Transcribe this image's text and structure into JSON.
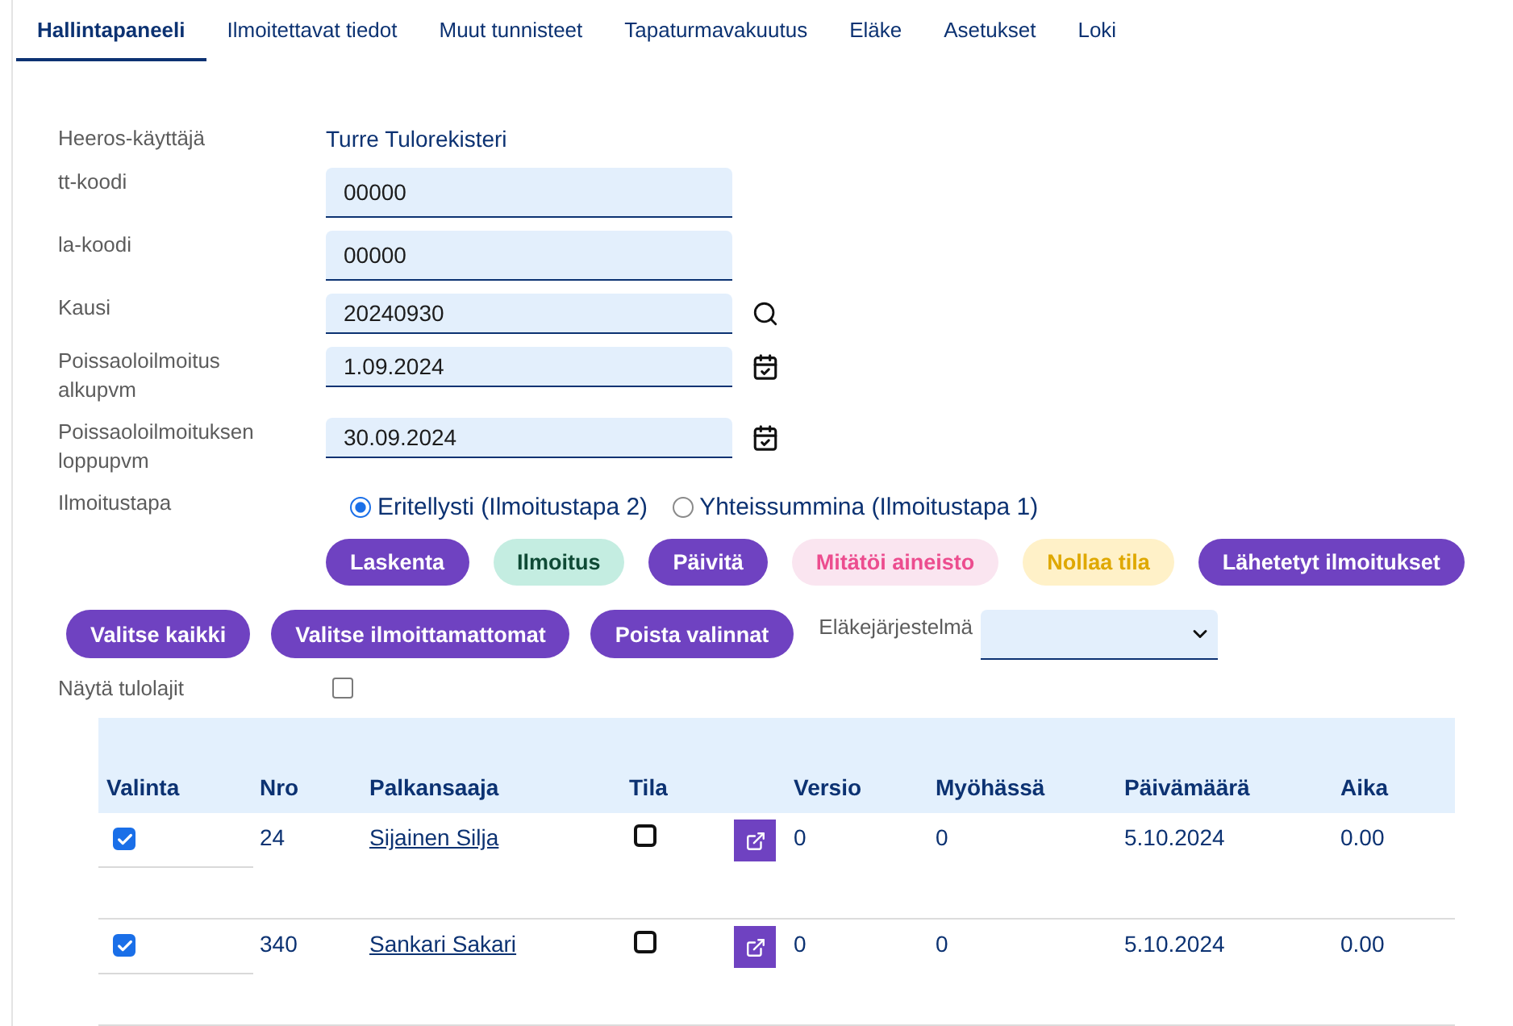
{
  "tabs": [
    {
      "label": "Hallintapaneeli",
      "selected": true
    },
    {
      "label": "Ilmoitettavat tiedot",
      "selected": false
    },
    {
      "label": "Muut tunnisteet",
      "selected": false
    },
    {
      "label": "Tapaturmavakuutus",
      "selected": false
    },
    {
      "label": "Eläke",
      "selected": false
    },
    {
      "label": "Asetukset",
      "selected": false
    },
    {
      "label": "Loki",
      "selected": false
    }
  ],
  "user": {
    "label": "Heeros-käyttäjä",
    "value": "Turre Tulorekisteri"
  },
  "fields": [
    {
      "kind": "text",
      "label": "tt-koodi",
      "value": "00000"
    },
    {
      "kind": "text",
      "label": "la-koodi",
      "value": "00000"
    },
    {
      "kind": "search",
      "label": "Kausi",
      "value": "20240930"
    },
    {
      "kind": "date",
      "label": "Poissaoloilmoitus alkupvm",
      "value": "1.09.2024"
    },
    {
      "kind": "date",
      "label": "Poissaoloilmoituksen loppupvm",
      "value": "30.09.2024"
    }
  ],
  "reporting_method": {
    "label": "Ilmoitustapa",
    "options": [
      {
        "label": "Eritellysti (Ilmoitustapa 2)",
        "selected": true
      },
      {
        "label": "Yhteissummina (Ilmoitustapa 1)",
        "selected": false
      }
    ]
  },
  "actions": [
    {
      "kind": "primary",
      "label": "Laskenta"
    },
    {
      "kind": "success",
      "label": "Ilmoitus"
    },
    {
      "kind": "primary",
      "label": "Päivitä"
    },
    {
      "kind": "danger",
      "label": "Mitätöi aineisto"
    },
    {
      "kind": "warning",
      "label": "Nollaa tila"
    },
    {
      "kind": "primary",
      "label": "Lähetetyt ilmoitukset"
    }
  ],
  "selection_buttons": [
    "Valitse kaikki",
    "Valitse ilmoittamattomat",
    "Poista valinnat"
  ],
  "pension_system": {
    "label": "Eläkejärjestelmä"
  },
  "show_income_types": {
    "label": "Näytä tulolajit",
    "checked": false
  },
  "table": {
    "columns": [
      "Valinta",
      "Nro",
      "Palkansaaja",
      "Tila",
      "Versio",
      "Myöhässä",
      "Päivämäärä",
      "Aika"
    ],
    "rows": [
      {
        "selected": true,
        "nro": "24",
        "name": "Sijainen Silja",
        "status_checked": false,
        "version": "0",
        "late": "0",
        "date": "5.10.2024",
        "time": "0.00"
      },
      {
        "selected": true,
        "nro": "340",
        "name": "Sankari Sakari",
        "status_checked": false,
        "version": "0",
        "late": "0",
        "date": "5.10.2024",
        "time": "0.00"
      }
    ]
  }
}
